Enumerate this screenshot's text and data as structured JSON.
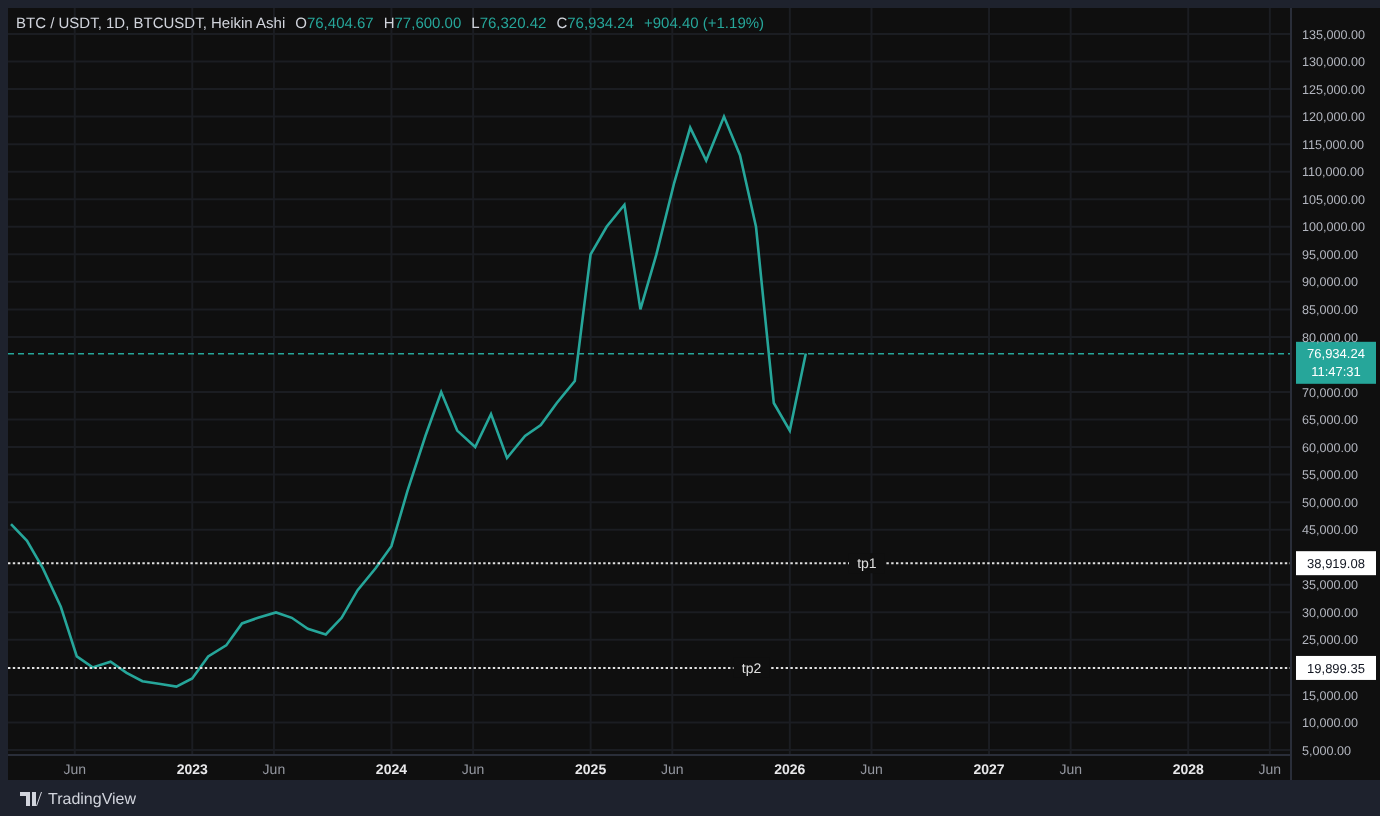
{
  "legend": {
    "symbol": "BTC / USDT, 1D, BTCUSDT, Heikin Ashi",
    "open": {
      "label": "O",
      "value": "76,404.67"
    },
    "high": {
      "label": "H",
      "value": "77,600.00"
    },
    "low": {
      "label": "L",
      "value": "76,320.42"
    },
    "close": {
      "label": "C",
      "value": "76,934.24"
    },
    "change": "+904.40 (+1.19%)"
  },
  "chart": {
    "chart_data": {
      "type": "line",
      "grid": true,
      "xlim": [
        2022.075,
        2028.511
      ],
      "ylim": [
        5000,
        135000
      ],
      "x": [
        2022.09,
        2022.17,
        2022.25,
        2022.34,
        2022.42,
        2022.5,
        2022.59,
        2022.67,
        2022.75,
        2022.84,
        2022.92,
        2023.0,
        2023.08,
        2023.17,
        2023.25,
        2023.33,
        2023.42,
        2023.5,
        2023.58,
        2023.67,
        2023.75,
        2023.83,
        2023.92,
        2024.0,
        2024.08,
        2024.17,
        2024.25,
        2024.33,
        2024.42,
        2024.5,
        2024.58,
        2024.67,
        2024.75,
        2024.83,
        2024.92,
        2025.0,
        2025.08,
        2025.17,
        2025.25,
        2025.33,
        2025.42,
        2025.5,
        2025.58,
        2025.67,
        2025.75,
        2025.83,
        2025.92,
        2026.0,
        2026.08
      ],
      "series": [
        {
          "color": "#26a69a",
          "line_style": "solid",
          "values": [
            46000,
            43000,
            38000,
            31000,
            22000,
            20000,
            21000,
            19000,
            17500,
            17000,
            16500,
            18000,
            22000,
            24000,
            28000,
            29000,
            30000,
            29000,
            27000,
            26000,
            29000,
            34000,
            38000,
            42000,
            52000,
            62000,
            70000,
            63000,
            60000,
            66000,
            58000,
            62000,
            64000,
            68000,
            72000,
            95000,
            100000,
            104000,
            85000,
            95000,
            108000,
            118000,
            112000,
            120000,
            113000,
            100000,
            68000,
            63000,
            77000
          ]
        }
      ],
      "xticks": [
        {
          "value": 2022.41,
          "label": "Jun"
        },
        {
          "value": 2023,
          "label": "2023"
        },
        {
          "value": 2023.41,
          "label": "Jun"
        },
        {
          "value": 2024,
          "label": "2024"
        },
        {
          "value": 2024.41,
          "label": "Jun"
        },
        {
          "value": 2025,
          "label": "2025"
        },
        {
          "value": 2025.41,
          "label": "Jun"
        },
        {
          "value": 2026,
          "label": "2026"
        },
        {
          "value": 2026.41,
          "label": "Jun"
        },
        {
          "value": 2027,
          "label": "2027"
        },
        {
          "value": 2027.41,
          "label": "Jun"
        },
        {
          "value": 2028,
          "label": "2028"
        },
        {
          "value": 2028.41,
          "label": "Jun"
        }
      ],
      "yticks": [
        {
          "value": 135000,
          "label": "135,000.00"
        },
        {
          "value": 130000,
          "label": "130,000.00"
        },
        {
          "value": 125000,
          "label": "125,000.00"
        },
        {
          "value": 120000,
          "label": "120,000.00"
        },
        {
          "value": 115000,
          "label": "115,000.00"
        },
        {
          "value": 110000,
          "label": "110,000.00"
        },
        {
          "value": 105000,
          "label": "105,000.00"
        },
        {
          "value": 100000,
          "label": "100,000.00"
        },
        {
          "value": 95000,
          "label": "95,000.00"
        },
        {
          "value": 90000,
          "label": "90,000.00"
        },
        {
          "value": 85000,
          "label": "85,000.00"
        },
        {
          "value": 80000,
          "label": "80,000.00"
        },
        {
          "value": 70000,
          "label": "70,000.00"
        },
        {
          "value": 65000,
          "label": "65,000.00"
        },
        {
          "value": 60000,
          "label": "60,000.00"
        },
        {
          "value": 55000,
          "label": "55,000.00"
        },
        {
          "value": 50000,
          "label": "50,000.00"
        },
        {
          "value": 45000,
          "label": "45,000.00"
        },
        {
          "value": 35000,
          "label": "35,000.00"
        },
        {
          "value": 30000,
          "label": "30,000.00"
        },
        {
          "value": 25000,
          "label": "25,000.00"
        },
        {
          "value": 15000,
          "label": "15,000.00"
        },
        {
          "value": 10000,
          "label": "10,000.00"
        },
        {
          "value": 5000,
          "label": "5,000.00"
        }
      ],
      "ref_lines": [
        {
          "axis": "y",
          "value": 76934.24,
          "color": "#26a69a"
        },
        {
          "axis": "y",
          "value": 38919.08,
          "label": "tp1",
          "color": "#e0e0e0"
        },
        {
          "axis": "y",
          "value": 19899.35,
          "label": "tp2",
          "color": "#e0e0e0"
        }
      ]
    }
  },
  "price_tags": [
    {
      "kind": "last",
      "label": "76,934.24",
      "countdown": "11:47:31"
    },
    {
      "kind": "target",
      "label": "38,919.08"
    },
    {
      "kind": "target",
      "label": "19,899.35"
    }
  ],
  "footer": {
    "brand": "TradingView"
  }
}
